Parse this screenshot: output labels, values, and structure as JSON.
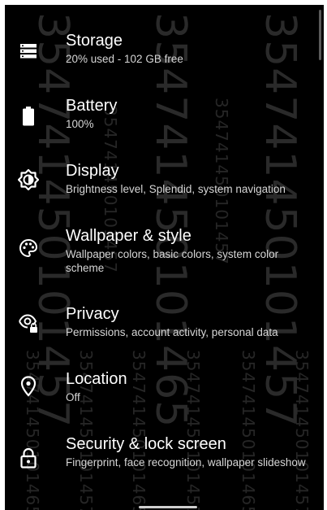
{
  "settings": {
    "items": [
      {
        "icon": "storage-icon",
        "title": "Storage",
        "subtitle": "20% used - 102 GB free"
      },
      {
        "icon": "battery-icon",
        "title": "Battery",
        "subtitle": "100%"
      },
      {
        "icon": "display-icon",
        "title": "Display",
        "subtitle": "Brightness level, Splendid, system navigation"
      },
      {
        "icon": "palette-icon",
        "title": "Wallpaper & style",
        "subtitle": "Wallpaper colors, basic colors, system color scheme"
      },
      {
        "icon": "privacy-eye-lock-icon",
        "title": "Privacy",
        "subtitle": "Permissions, account activity, personal data"
      },
      {
        "icon": "location-pin-icon",
        "title": "Location",
        "subtitle": "Off"
      },
      {
        "icon": "lock-icon",
        "title": "Security & lock screen",
        "subtitle": "Fingerprint, face recognition, wallpaper slideshow"
      }
    ]
  },
  "watermark": {
    "text": "354741450101457",
    "text_alt": "354741450101465"
  },
  "colors": {
    "background": "#000000",
    "title": "#ffffff",
    "subtitle": "#d6d6d6",
    "watermark": "#2f2f2f"
  }
}
